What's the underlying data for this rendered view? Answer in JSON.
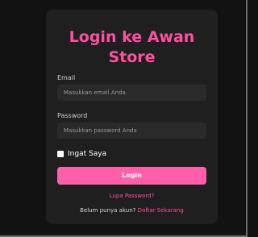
{
  "login": {
    "title_line1": "Login ke Awan",
    "title_line2": "Store",
    "email_label": "Email",
    "email_placeholder": "Masukkan email Anda",
    "password_label": "Password",
    "password_placeholder": "Masukkan password Anda",
    "remember_label": "Ingat Saya",
    "login_button": "Login",
    "forgot_password": "Lupa Password?",
    "register_prompt": "Belum punya akun?",
    "register_link": "Daftar Sekarang"
  },
  "colors": {
    "accent": "#ff4fa0",
    "button": "#ff5fa8",
    "card_bg": "#1f1f1f",
    "page_bg": "#121212"
  }
}
